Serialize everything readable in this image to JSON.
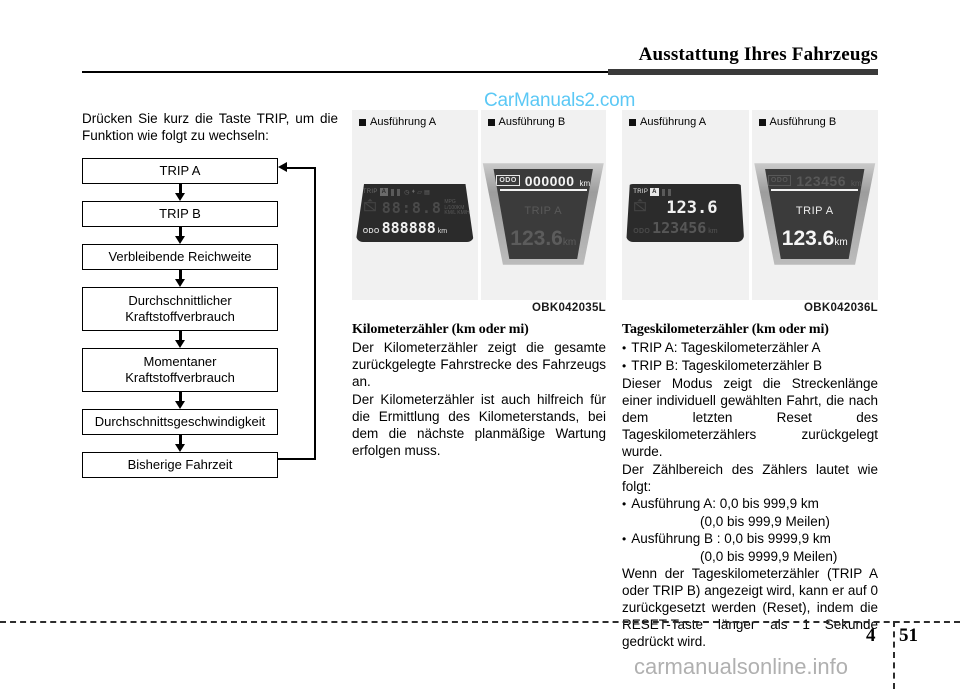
{
  "header": {
    "title": "Ausstattung Ihres Fahrzeugs"
  },
  "watermarks": {
    "top": "CarManuals2.com",
    "bottom": "carmanualsonline.info"
  },
  "footer": {
    "chapter": "4",
    "page": "51"
  },
  "left_column": {
    "intro": "Drücken Sie kurz die Taste TRIP, um die Funktion wie folgt zu wechseln:",
    "flow_boxes": [
      "TRIP A",
      "TRIP B",
      "Verbleibende Reichweite",
      "Durchschnittlicher Kraftstoffverbrauch",
      "Momentaner Kraftstoffverbrauch",
      "Durchschnittsgeschwindigkeit",
      "Bisherige Fahrzeit"
    ],
    "flow_boxes_lines": [
      [
        "TRIP A"
      ],
      [
        "TRIP B"
      ],
      [
        "Verbleibende Reichweite"
      ],
      [
        "Durchschnittlicher",
        "Kraftstoffverbrauch"
      ],
      [
        "Momentaner",
        "Kraftstoffverbrauch"
      ],
      [
        "Durchschnittsgeschwindigkeit"
      ],
      [
        "Bisherige Fahrzeit"
      ]
    ]
  },
  "figure_1": {
    "caption": "OBK042035L",
    "half_a": {
      "label": "Ausführung A",
      "display": {
        "trip_badge": "TRIP",
        "badge_letter": "A",
        "segment_value": "88:8.8",
        "odo_label": "ODO",
        "odo_value": "888888",
        "odo_unit": "km",
        "micro_text_1": "MPG",
        "micro_text_2": "L/100KM",
        "micro_text_3": "KM/L KM/H"
      }
    },
    "half_b": {
      "label": "Ausführung B",
      "display": {
        "odo_chip": "ODO",
        "odo_value": "000000",
        "odo_unit": "km",
        "trip_label": "TRIP A",
        "trip_value": "123.6",
        "trip_unit": "km"
      }
    }
  },
  "figure_2": {
    "caption": "OBK042036L",
    "half_a": {
      "label": "Ausführung A",
      "display": {
        "trip_badge": "TRIP",
        "badge_letter": "A",
        "segment_value": "123.6",
        "odo_label": "ODO",
        "odo_value": "123456",
        "odo_unit": "km"
      }
    },
    "half_b": {
      "label": "Ausführung B",
      "display": {
        "odo_chip": "ODO",
        "odo_value": "123456",
        "odo_unit": "km",
        "trip_label": "TRIP A",
        "trip_value": "123.6",
        "trip_unit": "km"
      }
    }
  },
  "mid_column": {
    "heading": "Kilometerzähler (km oder mi)",
    "para_1": "Der Kilometerzähler zeigt die gesamte zurückgelegte Fahrstrecke des Fahrzeugs an.",
    "para_2": "Der Kilometerzähler ist auch hilfreich für die Ermittlung des Kilometerstands, bei dem die nächste planmäßige Wartung erfolgen muss."
  },
  "right_column": {
    "heading": "Tageskilometerzähler (km oder mi)",
    "bullet_1": "TRIP A: Tageskilometerzähler A",
    "bullet_2": "TRIP B: Tageskilometerzähler B",
    "para_1": "Dieser Modus zeigt die Streckenlänge einer individuell gewählten Fahrt, die nach dem letzten Reset des Tageskilometerzählers zurückgelegt wurde.",
    "para_2": "Der Zählbereich des Zählers lautet wie folgt:",
    "bullet_3": "Ausführung A: 0,0 bis 999,9 km",
    "bullet_3_sub": "(0,0 bis 999,9 Meilen)",
    "bullet_4": "Ausführung B : 0,0 bis 9999,9 km",
    "bullet_4_sub": "(0,0 bis 9999,9 Meilen)",
    "para_3": "Wenn der Tageskilometerzähler (TRIP A oder TRIP B) angezeigt wird, kann er auf 0 zurückgesetzt werden (Reset), indem die RESET-Taste länger als 1 Sekunde gedrückt wird."
  }
}
